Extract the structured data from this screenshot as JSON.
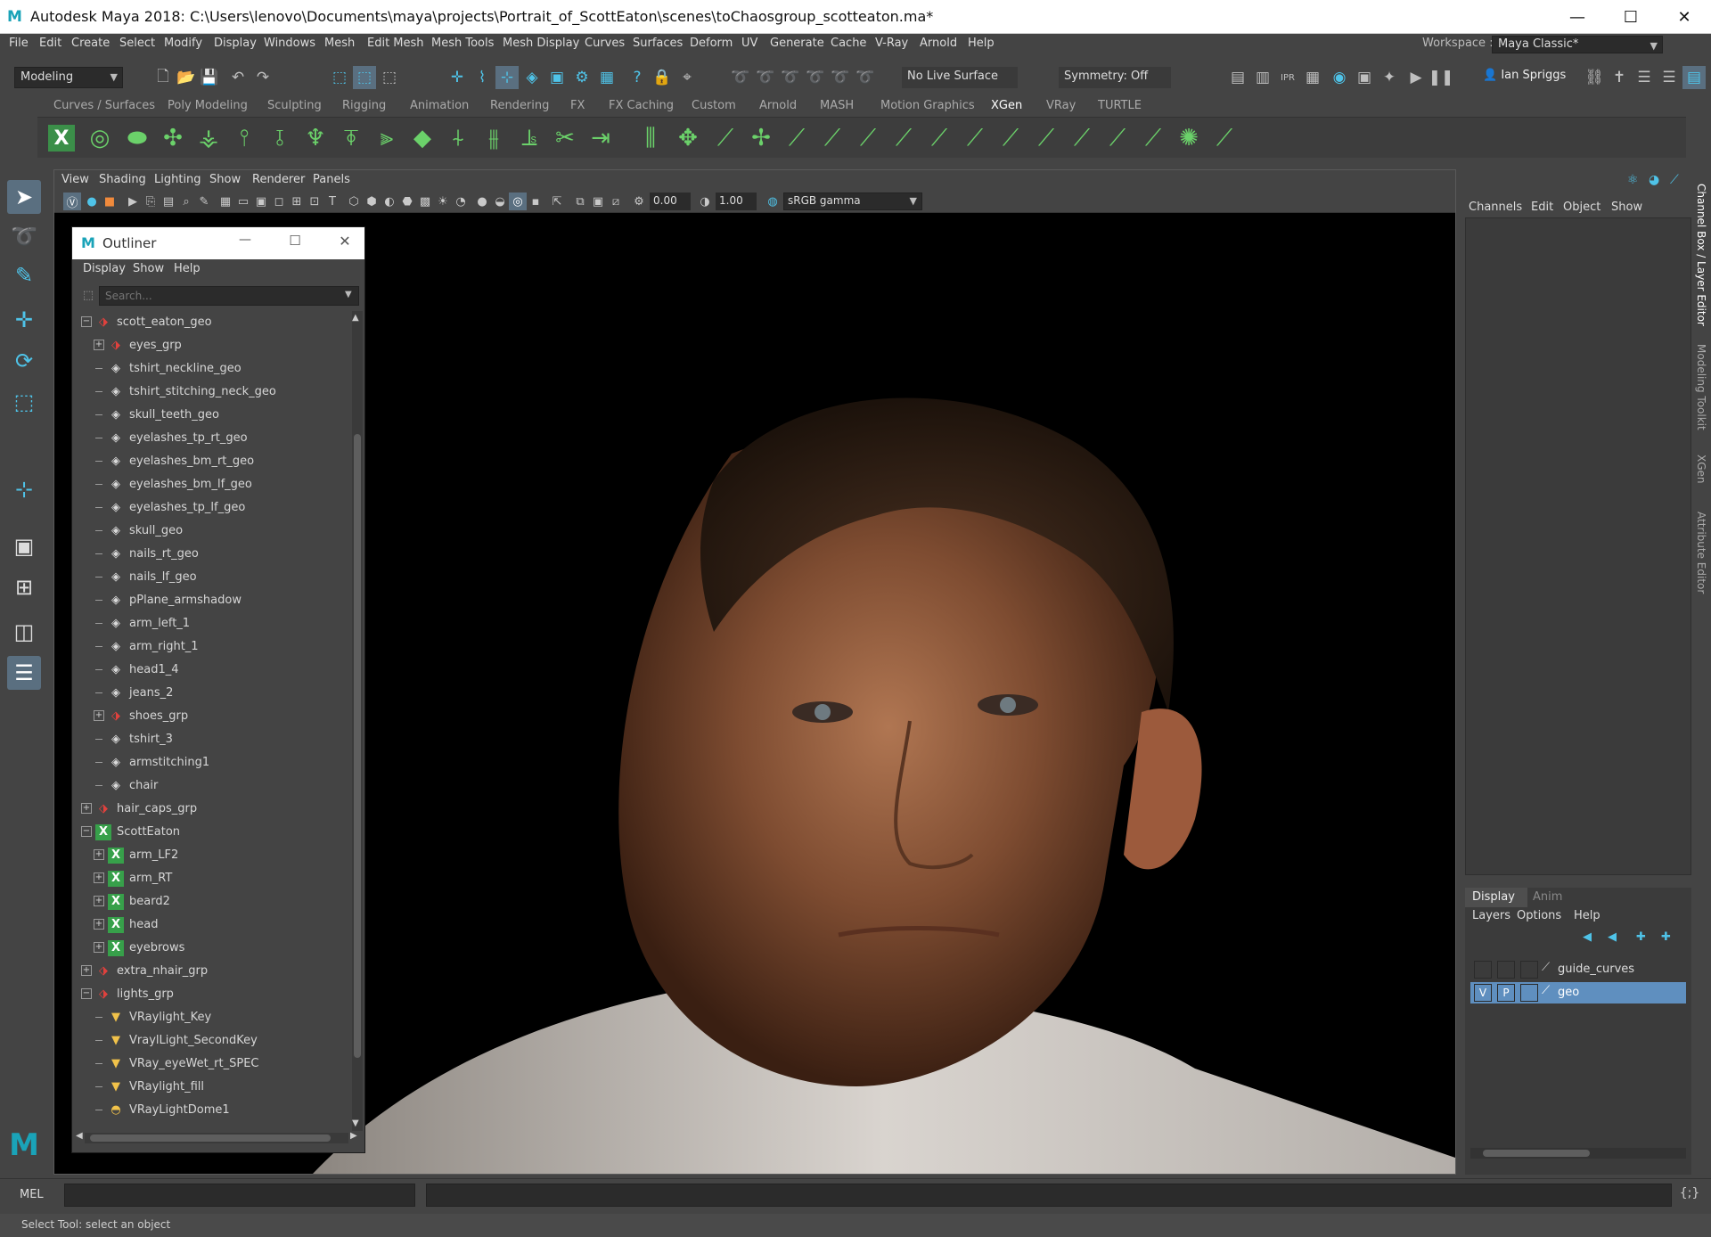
{
  "window": {
    "title": "Autodesk Maya 2018: C:\\Users\\lenovo\\Documents\\maya\\projects\\Portrait_of_ScottEaton\\scenes\\toChaosgroup_scotteaton.ma*",
    "logo": "M",
    "min": "—",
    "max": "☐",
    "close": "✕"
  },
  "menubar": [
    "File",
    "Edit",
    "Create",
    "Select",
    "Modify",
    "Display",
    "Windows",
    "Mesh",
    "Edit Mesh",
    "Mesh Tools",
    "Mesh Display",
    "Curves",
    "Surfaces",
    "Deform",
    "UV",
    "Generate",
    "Cache",
    "V-Ray",
    "Arnold",
    "Help"
  ],
  "workspace": {
    "label": "Workspace :",
    "value": "Maya Classic*"
  },
  "statusline": {
    "mode": "Modeling",
    "live_surface": "No Live Surface",
    "symmetry": "Symmetry: Off",
    "user": "Ian Spriggs"
  },
  "shelf_tabs": [
    "Curves / Surfaces",
    "Poly Modeling",
    "Sculpting",
    "Rigging",
    "Animation",
    "Rendering",
    "FX",
    "FX Caching",
    "Custom",
    "Arnold",
    "MASH",
    "Motion Graphics",
    "XGen",
    "VRay",
    "TURTLE"
  ],
  "active_shelf": "XGen",
  "viewport": {
    "menus": [
      "View",
      "Shading",
      "Lighting",
      "Show",
      "Renderer",
      "Panels"
    ],
    "exposure": "0.00",
    "gamma": "1.00",
    "colorspace": "sRGB gamma"
  },
  "outliner": {
    "title": "Outliner",
    "logo": "M",
    "menus": [
      "Display",
      "Show",
      "Help"
    ],
    "search_placeholder": "Search...",
    "items": [
      {
        "label": "scott_eaton_geo",
        "icon": "grp",
        "level": 0,
        "exp": "−"
      },
      {
        "label": "eyes_grp",
        "icon": "grp",
        "level": 1,
        "exp": "+"
      },
      {
        "label": "tshirt_neckline_geo",
        "icon": "mesh",
        "level": 1,
        "exp": ""
      },
      {
        "label": "tshirt_stitching_neck_geo",
        "icon": "mesh",
        "level": 1,
        "exp": ""
      },
      {
        "label": "skull_teeth_geo",
        "icon": "mesh",
        "level": 1,
        "exp": ""
      },
      {
        "label": "eyelashes_tp_rt_geo",
        "icon": "mesh",
        "level": 1,
        "exp": ""
      },
      {
        "label": "eyelashes_bm_rt_geo",
        "icon": "mesh",
        "level": 1,
        "exp": ""
      },
      {
        "label": "eyelashes_bm_lf_geo",
        "icon": "mesh",
        "level": 1,
        "exp": ""
      },
      {
        "label": "eyelashes_tp_lf_geo",
        "icon": "mesh",
        "level": 1,
        "exp": ""
      },
      {
        "label": "skull_geo",
        "icon": "mesh",
        "level": 1,
        "exp": ""
      },
      {
        "label": "nails_rt_geo",
        "icon": "mesh",
        "level": 1,
        "exp": ""
      },
      {
        "label": "nails_lf_geo",
        "icon": "mesh",
        "level": 1,
        "exp": ""
      },
      {
        "label": "pPlane_armshadow",
        "icon": "mesh",
        "level": 1,
        "exp": ""
      },
      {
        "label": "arm_left_1",
        "icon": "mesh",
        "level": 1,
        "exp": ""
      },
      {
        "label": "arm_right_1",
        "icon": "mesh",
        "level": 1,
        "exp": ""
      },
      {
        "label": "head1_4",
        "icon": "mesh",
        "level": 1,
        "exp": ""
      },
      {
        "label": "jeans_2",
        "icon": "mesh",
        "level": 1,
        "exp": ""
      },
      {
        "label": "shoes_grp",
        "icon": "grp",
        "level": 1,
        "exp": "+"
      },
      {
        "label": "tshirt_3",
        "icon": "mesh",
        "level": 1,
        "exp": ""
      },
      {
        "label": "armstitching1",
        "icon": "mesh",
        "level": 1,
        "exp": ""
      },
      {
        "label": "chair",
        "icon": "mesh",
        "level": 1,
        "exp": ""
      },
      {
        "label": "hair_caps_grp",
        "icon": "grp",
        "level": 0,
        "exp": "+"
      },
      {
        "label": "ScottEaton",
        "icon": "xgen",
        "level": 0,
        "exp": "−"
      },
      {
        "label": "arm_LF2",
        "icon": "xgen",
        "level": 1,
        "exp": "+"
      },
      {
        "label": "arm_RT",
        "icon": "xgen",
        "level": 1,
        "exp": "+"
      },
      {
        "label": "beard2",
        "icon": "xgen",
        "level": 1,
        "exp": "+"
      },
      {
        "label": "head",
        "icon": "xgen",
        "level": 1,
        "exp": "+"
      },
      {
        "label": "eyebrows",
        "icon": "xgen",
        "level": 1,
        "exp": "+"
      },
      {
        "label": "extra_nhair_grp",
        "icon": "grp",
        "level": 0,
        "exp": "+"
      },
      {
        "label": "lights_grp",
        "icon": "grp",
        "level": 0,
        "exp": "−"
      },
      {
        "label": "VRaylight_Key",
        "icon": "light",
        "level": 1,
        "exp": ""
      },
      {
        "label": "VraylLight_SecondKey",
        "icon": "light",
        "level": 1,
        "exp": ""
      },
      {
        "label": "VRay_eyeWet_rt_SPEC",
        "icon": "light",
        "level": 1,
        "exp": ""
      },
      {
        "label": "VRaylight_fill",
        "icon": "light",
        "level": 1,
        "exp": ""
      },
      {
        "label": "VRayLightDome1",
        "icon": "dome",
        "level": 1,
        "exp": ""
      }
    ]
  },
  "channelbox": {
    "menus": [
      "Channels",
      "Edit",
      "Object",
      "Show"
    ]
  },
  "layers": {
    "tabs": [
      "Display",
      "Anim"
    ],
    "menus": [
      "Layers",
      "Options",
      "Help"
    ],
    "rows": [
      {
        "v": "",
        "p": "",
        "name": "guide_curves",
        "selected": false
      },
      {
        "v": "V",
        "p": "P",
        "name": "geo",
        "selected": true
      }
    ]
  },
  "side_tabs": [
    "Channel Box / Layer Editor",
    "Modeling Toolkit",
    "XGen",
    "Attribute Editor"
  ],
  "cmdline": {
    "label": "MEL"
  },
  "helpline": "Select Tool: select an object",
  "colors": {
    "accent": "#4fc3e8",
    "xgen_green": "#37a04a",
    "selection": "#5f8fbf"
  }
}
